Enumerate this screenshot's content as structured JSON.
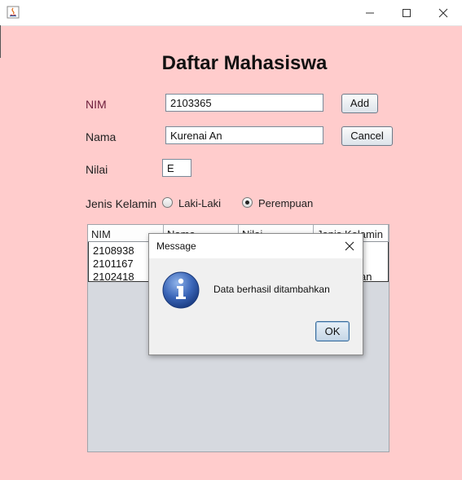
{
  "window": {
    "title": ""
  },
  "form": {
    "heading": "Daftar Mahasiswa",
    "nim_label": "NIM",
    "nim_value": "2103365",
    "nama_label": "Nama",
    "nama_value": "Kurenai An",
    "nilai_label": "Nilai",
    "nilai_value": "E",
    "gender_label": "Jenis Kelamin",
    "gender_options": [
      "Laki-Laki",
      "Perempuan"
    ],
    "gender_selected": "Perempuan",
    "add_label": "Add",
    "cancel_label": "Cancel"
  },
  "table": {
    "headers": [
      "NIM",
      "Nama",
      "Nilai",
      "Jenis Kelamin"
    ],
    "rows": [
      {
        "nim": "2108938",
        "last": ""
      },
      {
        "nim": "2101167",
        "last": ""
      },
      {
        "nim": "2102418",
        "last": "an"
      }
    ]
  },
  "dialog": {
    "title": "Message",
    "message": "Data berhasil ditambahkan",
    "ok_label": "OK",
    "icon": "info-icon"
  },
  "colors": {
    "background": "#ffcccc",
    "accent": "#3c6e9c"
  }
}
